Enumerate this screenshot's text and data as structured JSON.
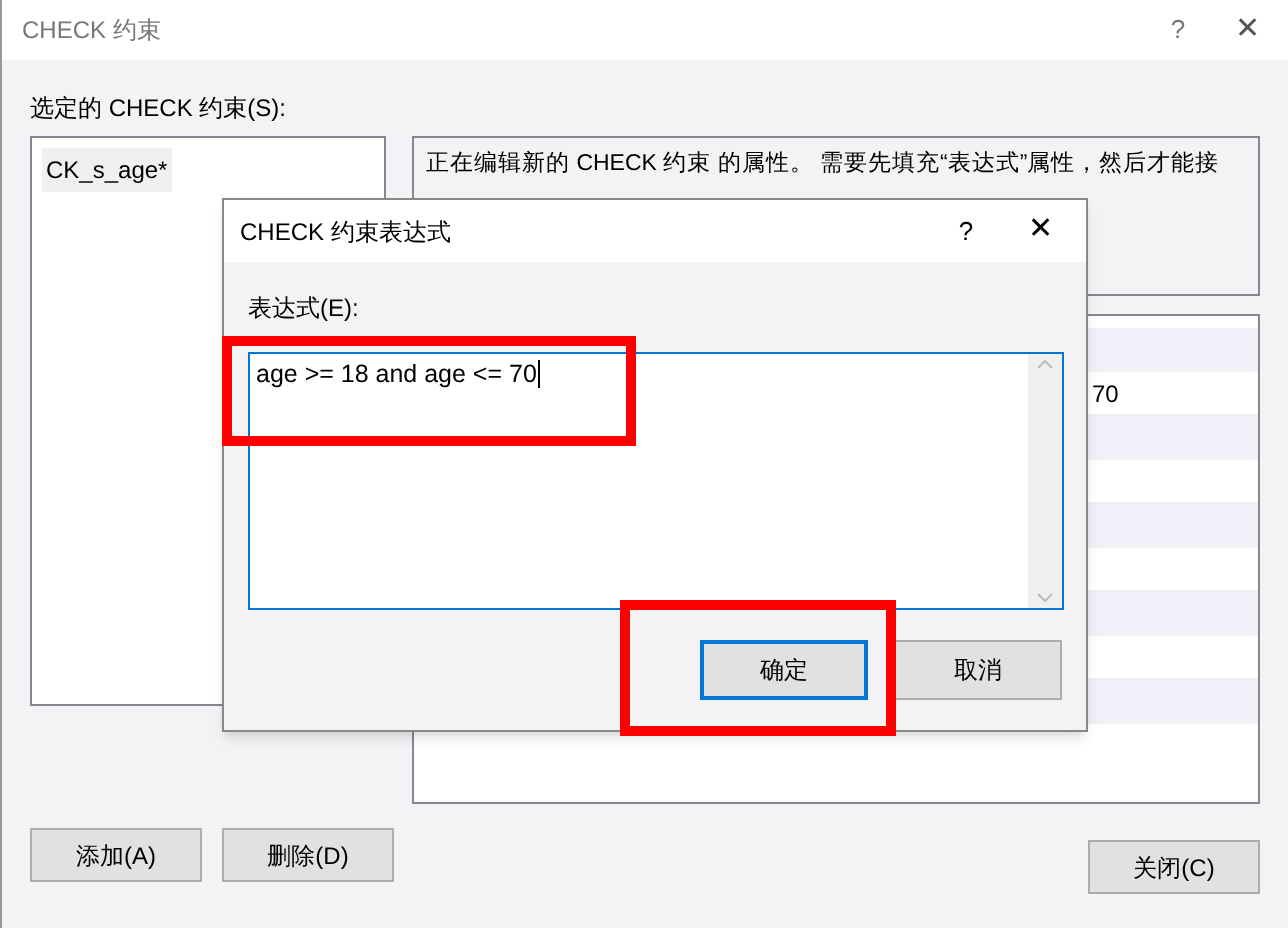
{
  "window": {
    "title": "CHECK 约束",
    "help": "?",
    "close": "✕"
  },
  "list_label": "选定的 CHECK 约束(S):",
  "constraints": [
    {
      "name": "CK_s_age*",
      "selected": true
    }
  ],
  "description": "正在编辑新的 CHECK 约束 的属性。 需要先填充“表达式”属性，然后才能接",
  "properties": {
    "rows": [
      {},
      {
        "value": "70"
      },
      {},
      {},
      {},
      {},
      {},
      {},
      {}
    ]
  },
  "buttons": [
    {
      "label": "添加(A)"
    },
    {
      "label": "删除(D)"
    }
  ],
  "close_button": "关闭(C)",
  "dialog": {
    "title": "CHECK 约束表达式",
    "help": "?",
    "close": "✕",
    "field_label": "表达式(E):",
    "expression": "age >= 18 and age <= 70",
    "expression_highlighted": true,
    "buttons": [
      {
        "label": "确定",
        "default": true,
        "highlighted": true
      },
      {
        "label": "取消",
        "default": false,
        "highlighted": false
      }
    ]
  }
}
